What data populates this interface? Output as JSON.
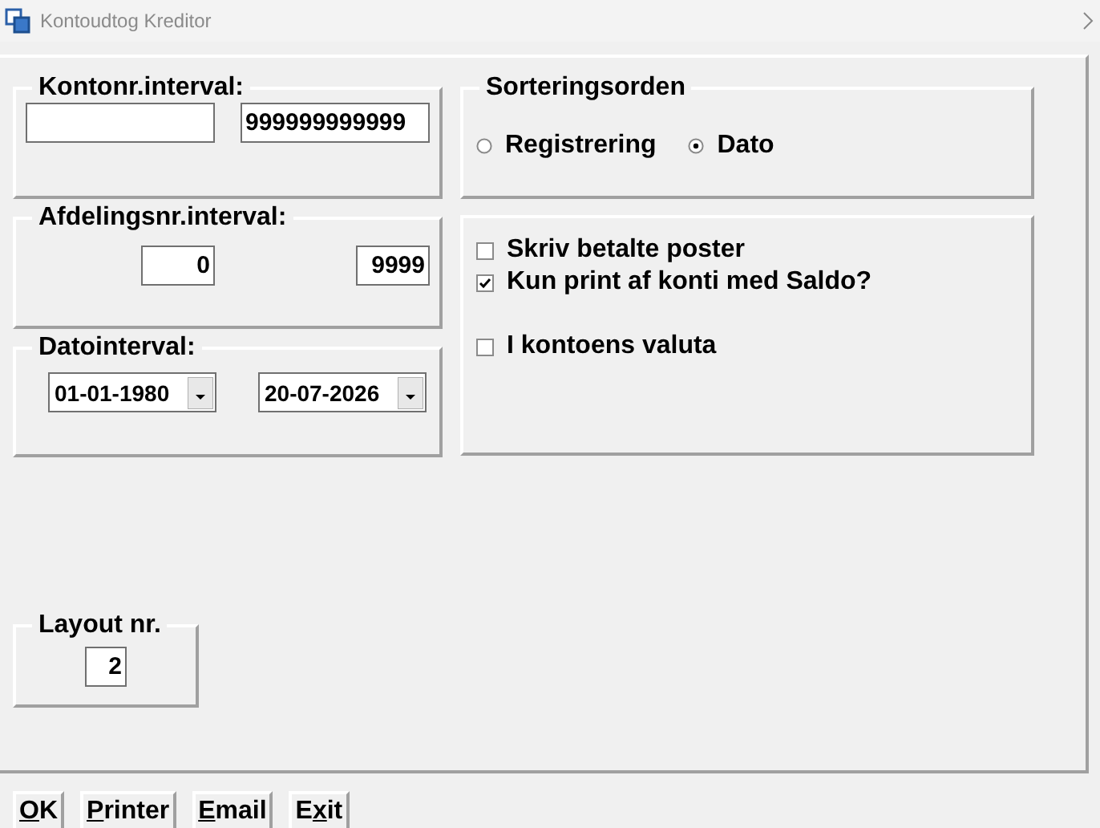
{
  "window": {
    "title": "Kontoudtog Kreditor"
  },
  "account_interval": {
    "legend": "Kontonr.interval:",
    "to": "999999999999"
  },
  "department_interval": {
    "legend": "Afdelingsnr.interval:",
    "from": "0",
    "to": "9999"
  },
  "date_interval": {
    "legend": "Datointerval:",
    "from": "01-01-1980",
    "to": "20-07-2026"
  },
  "sort_order": {
    "legend": "Sorteringsorden",
    "options": [
      {
        "label": "Registrering",
        "selected": false
      },
      {
        "label": "Dato",
        "selected": true
      }
    ]
  },
  "print_options": [
    {
      "label": "Skriv betalte poster",
      "checked": false
    },
    {
      "label": "Kun print af konti med Saldo?",
      "checked": true
    },
    {
      "label": "I kontoens valuta",
      "checked": false
    }
  ],
  "layout": {
    "legend": "Layout nr.",
    "value": "2"
  },
  "buttons": [
    {
      "key": "O",
      "post": "K"
    },
    {
      "key": "P",
      "post": "rinter"
    },
    {
      "key": "E",
      "post": "mail"
    },
    {
      "pre": "E",
      "key": "x",
      "post": "it"
    }
  ]
}
